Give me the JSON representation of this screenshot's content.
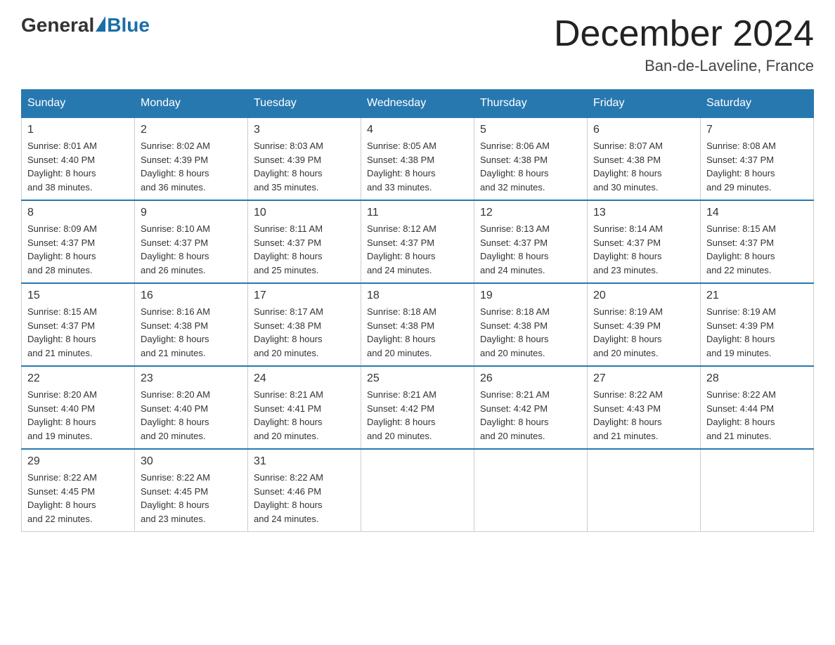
{
  "header": {
    "logo_general": "General",
    "logo_blue": "Blue",
    "title": "December 2024",
    "subtitle": "Ban-de-Laveline, France"
  },
  "days_of_week": [
    "Sunday",
    "Monday",
    "Tuesday",
    "Wednesday",
    "Thursday",
    "Friday",
    "Saturday"
  ],
  "weeks": [
    [
      {
        "num": "1",
        "sunrise": "8:01 AM",
        "sunset": "4:40 PM",
        "daylight": "8 hours and 38 minutes."
      },
      {
        "num": "2",
        "sunrise": "8:02 AM",
        "sunset": "4:39 PM",
        "daylight": "8 hours and 36 minutes."
      },
      {
        "num": "3",
        "sunrise": "8:03 AM",
        "sunset": "4:39 PM",
        "daylight": "8 hours and 35 minutes."
      },
      {
        "num": "4",
        "sunrise": "8:05 AM",
        "sunset": "4:38 PM",
        "daylight": "8 hours and 33 minutes."
      },
      {
        "num": "5",
        "sunrise": "8:06 AM",
        "sunset": "4:38 PM",
        "daylight": "8 hours and 32 minutes."
      },
      {
        "num": "6",
        "sunrise": "8:07 AM",
        "sunset": "4:38 PM",
        "daylight": "8 hours and 30 minutes."
      },
      {
        "num": "7",
        "sunrise": "8:08 AM",
        "sunset": "4:37 PM",
        "daylight": "8 hours and 29 minutes."
      }
    ],
    [
      {
        "num": "8",
        "sunrise": "8:09 AM",
        "sunset": "4:37 PM",
        "daylight": "8 hours and 28 minutes."
      },
      {
        "num": "9",
        "sunrise": "8:10 AM",
        "sunset": "4:37 PM",
        "daylight": "8 hours and 26 minutes."
      },
      {
        "num": "10",
        "sunrise": "8:11 AM",
        "sunset": "4:37 PM",
        "daylight": "8 hours and 25 minutes."
      },
      {
        "num": "11",
        "sunrise": "8:12 AM",
        "sunset": "4:37 PM",
        "daylight": "8 hours and 24 minutes."
      },
      {
        "num": "12",
        "sunrise": "8:13 AM",
        "sunset": "4:37 PM",
        "daylight": "8 hours and 24 minutes."
      },
      {
        "num": "13",
        "sunrise": "8:14 AM",
        "sunset": "4:37 PM",
        "daylight": "8 hours and 23 minutes."
      },
      {
        "num": "14",
        "sunrise": "8:15 AM",
        "sunset": "4:37 PM",
        "daylight": "8 hours and 22 minutes."
      }
    ],
    [
      {
        "num": "15",
        "sunrise": "8:15 AM",
        "sunset": "4:37 PM",
        "daylight": "8 hours and 21 minutes."
      },
      {
        "num": "16",
        "sunrise": "8:16 AM",
        "sunset": "4:38 PM",
        "daylight": "8 hours and 21 minutes."
      },
      {
        "num": "17",
        "sunrise": "8:17 AM",
        "sunset": "4:38 PM",
        "daylight": "8 hours and 20 minutes."
      },
      {
        "num": "18",
        "sunrise": "8:18 AM",
        "sunset": "4:38 PM",
        "daylight": "8 hours and 20 minutes."
      },
      {
        "num": "19",
        "sunrise": "8:18 AM",
        "sunset": "4:38 PM",
        "daylight": "8 hours and 20 minutes."
      },
      {
        "num": "20",
        "sunrise": "8:19 AM",
        "sunset": "4:39 PM",
        "daylight": "8 hours and 20 minutes."
      },
      {
        "num": "21",
        "sunrise": "8:19 AM",
        "sunset": "4:39 PM",
        "daylight": "8 hours and 19 minutes."
      }
    ],
    [
      {
        "num": "22",
        "sunrise": "8:20 AM",
        "sunset": "4:40 PM",
        "daylight": "8 hours and 19 minutes."
      },
      {
        "num": "23",
        "sunrise": "8:20 AM",
        "sunset": "4:40 PM",
        "daylight": "8 hours and 20 minutes."
      },
      {
        "num": "24",
        "sunrise": "8:21 AM",
        "sunset": "4:41 PM",
        "daylight": "8 hours and 20 minutes."
      },
      {
        "num": "25",
        "sunrise": "8:21 AM",
        "sunset": "4:42 PM",
        "daylight": "8 hours and 20 minutes."
      },
      {
        "num": "26",
        "sunrise": "8:21 AM",
        "sunset": "4:42 PM",
        "daylight": "8 hours and 20 minutes."
      },
      {
        "num": "27",
        "sunrise": "8:22 AM",
        "sunset": "4:43 PM",
        "daylight": "8 hours and 21 minutes."
      },
      {
        "num": "28",
        "sunrise": "8:22 AM",
        "sunset": "4:44 PM",
        "daylight": "8 hours and 21 minutes."
      }
    ],
    [
      {
        "num": "29",
        "sunrise": "8:22 AM",
        "sunset": "4:45 PM",
        "daylight": "8 hours and 22 minutes."
      },
      {
        "num": "30",
        "sunrise": "8:22 AM",
        "sunset": "4:45 PM",
        "daylight": "8 hours and 23 minutes."
      },
      {
        "num": "31",
        "sunrise": "8:22 AM",
        "sunset": "4:46 PM",
        "daylight": "8 hours and 24 minutes."
      },
      null,
      null,
      null,
      null
    ]
  ],
  "labels": {
    "sunrise": "Sunrise:",
    "sunset": "Sunset:",
    "daylight": "Daylight:"
  }
}
